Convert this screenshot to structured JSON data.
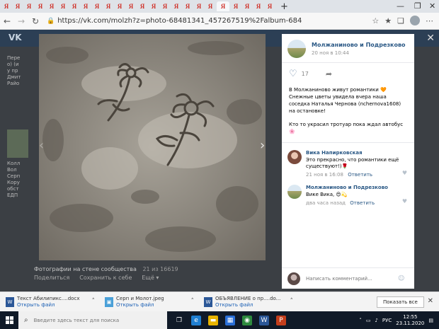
{
  "browser": {
    "tab_glyph": "Я",
    "tab_count": 24,
    "address": "https://vk.com/molzh?z=photo-68481341_457267519%2Falbum-68481341_00%2Fr...",
    "new_tab": "+",
    "minimize": "—",
    "restore": "❐"
  },
  "vk": {
    "logo": "VK"
  },
  "left_peek": [
    "Пере",
    "о) (и",
    "у пр",
    "Дмит",
    "Райо",
    "Колл",
    "Вол",
    "Серп",
    "Кору",
    "обст",
    "ЕДП"
  ],
  "photo": {
    "album_label": "Фотографии на стене сообщества",
    "counter": "21 из 16619",
    "share": "Поделиться",
    "save": "Сохранить к себе",
    "more": "Ещё ▾"
  },
  "post": {
    "group_name": "Молжаниново и Подрезково",
    "date": "20 ноя в 10:44",
    "likes": "17",
    "text_p1": "В Молжаниново живут романтики 🧡 Снежные цветы увидела вчера наша соседка Наталья Чернова (nchernova1608) на остановке!",
    "text_p2": "Кто то украсил тротуар пока ждал автобус 🌸"
  },
  "comments": [
    {
      "author": "Вика Напирковская",
      "text": "Это прекрасно, что романтики ещё существуют!)🌹",
      "date": "21 ноя в 16:08",
      "reply": "Ответить"
    },
    {
      "author": "Молжаниново и Подрезково",
      "text": "Вике Вика, 😍💫",
      "date": "два часа назад",
      "reply": "Ответить"
    }
  ],
  "comment_input": {
    "placeholder": "Написать комментарий..."
  },
  "downloads": {
    "items": [
      {
        "name": "Текст Абилипикс....docx",
        "open": "Открыть файл"
      },
      {
        "name": "Серп и Молот.jpeg",
        "open": "Открыть файл"
      },
      {
        "name": "ОБЪЯВЛЕНИЕ о пр....do...",
        "open": "Открыть файл"
      }
    ],
    "show_all": "Показать все"
  },
  "taskbar": {
    "search_placeholder": "Введите здесь текст для поиска",
    "lang": "РУС",
    "time": "12:55",
    "date": "23.11.2020"
  },
  "colors": {
    "vk_blue": "#2a5885",
    "overlay": "#1e1e1e",
    "taskbar": "#101a28"
  }
}
